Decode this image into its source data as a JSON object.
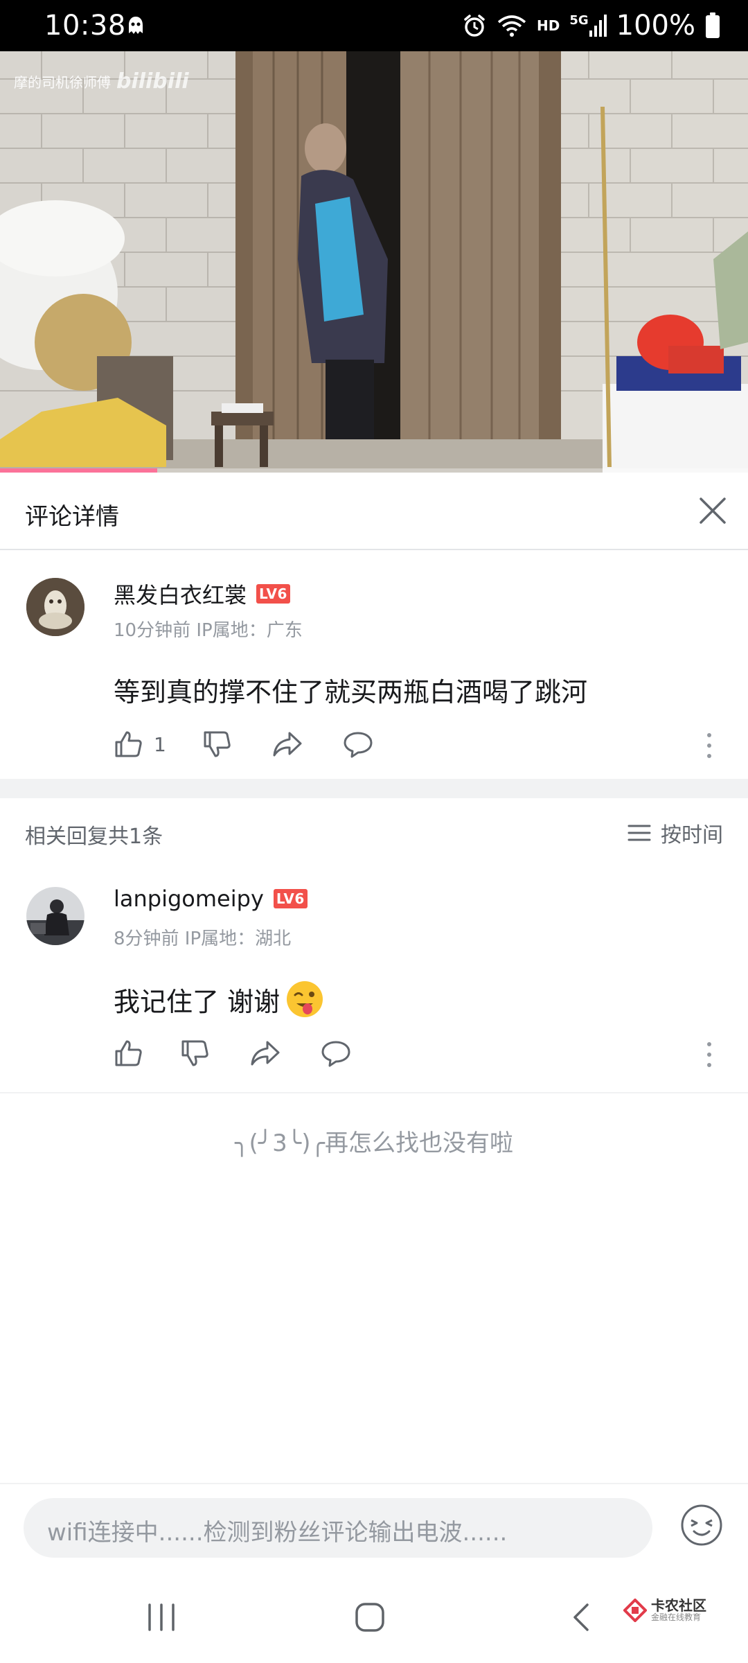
{
  "status_bar": {
    "time": "10:38",
    "network": "HD",
    "signal": "5G",
    "battery": "100%"
  },
  "video": {
    "watermark": "摩的司机徐师傅",
    "logo": "bilibili",
    "progress": 0.21
  },
  "header": {
    "title": "评论详情"
  },
  "main_comment": {
    "username": "黑发白衣红裳",
    "level": "LV6",
    "meta": "10分钟前 IP属地：广东",
    "text": "等到真的撑不住了就买两瓶白酒喝了跳河",
    "likes": "1"
  },
  "replies_header": {
    "count_label": "相关回复共1条",
    "sort_label": "按时间"
  },
  "replies": [
    {
      "username": "lanpigomeipy",
      "level": "LV6",
      "meta": "8分钟前 IP属地：湖北",
      "text": "我记住了 谢谢"
    }
  ],
  "end_text": "╮(╯3╰)╭再怎么找也没有啦",
  "input": {
    "placeholder": "wifi连接中......检测到粉丝评论输出电波......"
  },
  "brand": {
    "name": "卡农社区",
    "sub": "金融在线教育"
  },
  "colors": {
    "accent": "#fb7299",
    "level_badge": "#f2504a"
  }
}
